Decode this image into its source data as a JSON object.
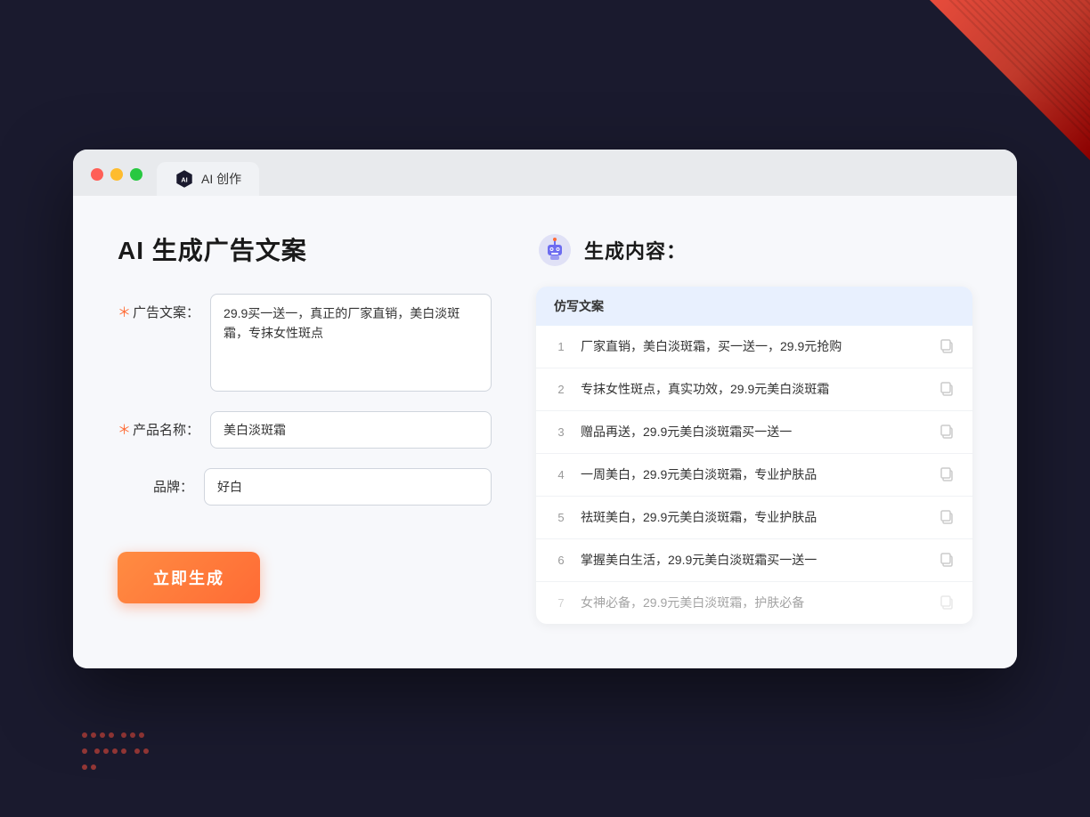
{
  "window": {
    "tab_label": "AI 创作"
  },
  "left_panel": {
    "title": "AI 生成广告文案",
    "ad_copy_label": "广告文案：",
    "ad_copy_required": "＊",
    "ad_copy_value": "29.9买一送一，真正的厂家直销，美白淡斑霜，专抹女性斑点",
    "product_name_label": "产品名称：",
    "product_name_required": "＊",
    "product_name_value": "美白淡斑霜",
    "brand_label": "品牌：",
    "brand_value": "好白",
    "generate_button": "立即生成"
  },
  "right_panel": {
    "title": "生成内容：",
    "column_header": "仿写文案",
    "results": [
      {
        "number": "1",
        "text": "厂家直销，美白淡斑霜，买一送一，29.9元抢购",
        "dimmed": false
      },
      {
        "number": "2",
        "text": "专抹女性斑点，真实功效，29.9元美白淡斑霜",
        "dimmed": false
      },
      {
        "number": "3",
        "text": "赠品再送，29.9元美白淡斑霜买一送一",
        "dimmed": false
      },
      {
        "number": "4",
        "text": "一周美白，29.9元美白淡斑霜，专业护肤品",
        "dimmed": false
      },
      {
        "number": "5",
        "text": "祛斑美白，29.9元美白淡斑霜，专业护肤品",
        "dimmed": false
      },
      {
        "number": "6",
        "text": "掌握美白生活，29.9元美白淡斑霜买一送一",
        "dimmed": false
      },
      {
        "number": "7",
        "text": "女神必备，29.9元美白淡斑霜，护肤必备",
        "dimmed": true
      }
    ]
  },
  "colors": {
    "orange": "#ff6b35",
    "blue_accent": "#5b8def",
    "header_bg": "#e8f0fe"
  }
}
